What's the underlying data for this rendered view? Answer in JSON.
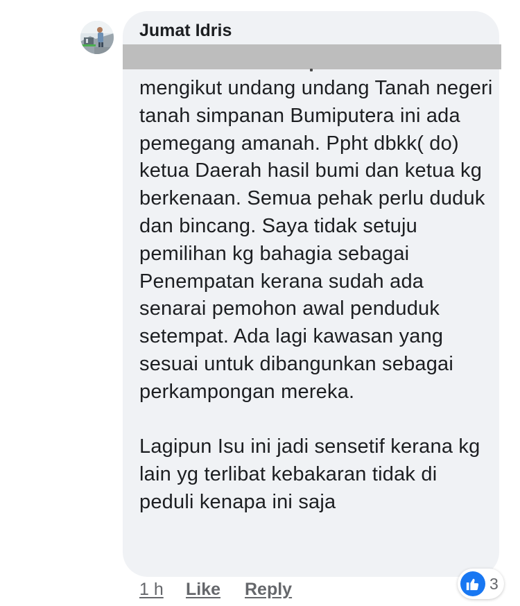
{
  "comment": {
    "author": "Jumat Idris",
    "body": "mengikut undang undang Tanah negeri tanah simpanan Bumiputera ini ada pemegang amanah. Ppht dbkk( do) ketua Daerah hasil bumi dan ketua kg berkenaan. Semua pehak perlu duduk dan bincang. Saya tidak setuju pemilihan kg bahagia sebagai Penempatan kerana sudah ada senarai pemohon awal penduduk setempat. Ada lagi kawasan yang sesuai untuk dibangunkan sebagai perkampongan mereka.\n\nLagipun Isu ini jadi sensetif kerana kg lain yg terlibat kebakaran tidak di peduli kenapa ini saja",
    "timestamp": "1 h",
    "like_label": "Like",
    "reply_label": "Reply",
    "reaction_count": "3",
    "reaction_icon": "thumbs-up-icon"
  },
  "colors": {
    "bubble": "#f0f2f5",
    "redaction": "#bdbdbd",
    "text": "#1c1e21",
    "secondary_text": "#65676b",
    "reaction_blue": "#1877f2"
  }
}
